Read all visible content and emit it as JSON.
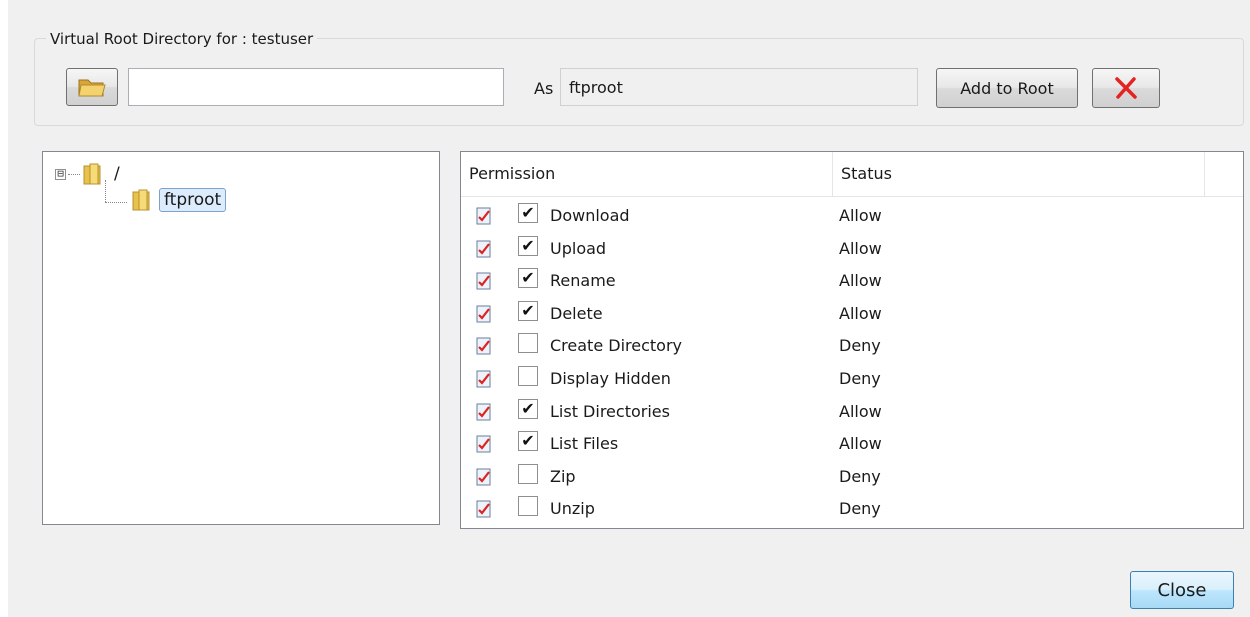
{
  "group": {
    "legend": "Virtual Root Directory for : testuser",
    "path_value": "",
    "as_label": "As",
    "alias_value": "ftproot",
    "add_root_label": "Add to Root",
    "browse_icon": "folder-open-icon",
    "remove_icon": "red-x-icon"
  },
  "tree": {
    "root": {
      "label": "/",
      "expanded": true,
      "expander": "⊟"
    },
    "child": {
      "label": "ftproot",
      "selected": true
    }
  },
  "permissions": {
    "headers": {
      "permission": "Permission",
      "status": "Status"
    },
    "rows": [
      {
        "name": "Download",
        "checked": "✔",
        "status": "Allow"
      },
      {
        "name": "Upload",
        "checked": "✔",
        "status": "Allow"
      },
      {
        "name": "Rename",
        "checked": "✔",
        "status": "Allow"
      },
      {
        "name": "Delete",
        "checked": "✔",
        "status": "Allow"
      },
      {
        "name": "Create Directory",
        "checked": "",
        "status": "Deny"
      },
      {
        "name": "Display Hidden",
        "checked": "",
        "status": "Deny"
      },
      {
        "name": "List Directories",
        "checked": "✔",
        "status": "Allow"
      },
      {
        "name": "List Files",
        "checked": "✔",
        "status": "Allow"
      },
      {
        "name": "Zip",
        "checked": "",
        "status": "Deny"
      },
      {
        "name": "Unzip",
        "checked": "",
        "status": "Deny"
      }
    ]
  },
  "footer": {
    "close_label": "Close"
  },
  "colors": {
    "remove_x": "#e52222",
    "folder": "#e8c24a",
    "selection": "#dcecfc"
  }
}
